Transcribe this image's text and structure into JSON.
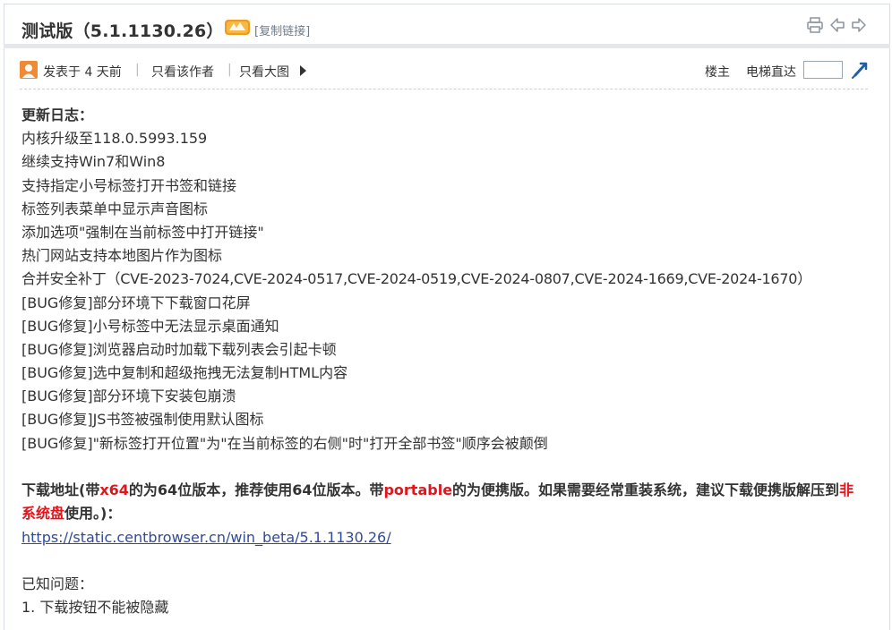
{
  "post": {
    "title": "测试版（5.1.1130.26）",
    "copy_link": "[复制链接]"
  },
  "meta": {
    "posted": "发表于 4 天前",
    "separator": "|",
    "author_only": "只看该作者",
    "big_image": "只看大图",
    "floor_owner": "楼主",
    "elevator": "电梯直达"
  },
  "content": {
    "heading": "更新日志：",
    "lines": [
      "内核升级至118.0.5993.159",
      "继续支持Win7和Win8",
      "支持指定小号标签打开书签和链接",
      "标签列表菜单中显示声音图标",
      "添加选项\"强制在当前标签中打开链接\"",
      "热门网站支持本地图片作为图标",
      "合并安全补丁（CVE-2023-7024,CVE-2024-0517,CVE-2024-0519,CVE-2024-0807,CVE-2024-1669,CVE-2024-1670）",
      "[BUG修复]部分环境下下载窗口花屏",
      "[BUG修复]小号标签中无法显示桌面通知",
      "[BUG修复]浏览器启动时加载下载列表会引起卡顿",
      "[BUG修复]选中复制和超级拖拽无法复制HTML内容",
      "[BUG修复]部分环境下安装包崩溃",
      "[BUG修复]JS书签被强制使用默认图标",
      "[BUG修复]\"新标签打开位置\"为\"在当前标签的右侧\"时\"打开全部书签\"顺序会被颠倒"
    ],
    "download": {
      "p1": "下载地址(带",
      "r1": "x64",
      "p2": "的为64位版本，推荐使用64位版本。带",
      "r2": "portable",
      "p3": "的为便携版。如果需要经常重装系统，建议下载便携版解压到",
      "r3": "非系统盘",
      "p4": "使用。)：",
      "url": "https://static.centbrowser.cn/win_beta/5.1.1130.26/"
    },
    "known_title": "已知问题：",
    "known_items": [
      "1. 下载按钮不能被隐藏"
    ]
  },
  "colors": {
    "accent_red": "#e4141b",
    "link_blue": "#2f4a9a",
    "avatar_orange": "#f08a35"
  },
  "icons": [
    "vip-badge-icon",
    "print-icon",
    "prev-post-icon",
    "next-post-icon",
    "user-avatar-icon",
    "arrow-right-icon",
    "jump-floor-icon"
  ]
}
